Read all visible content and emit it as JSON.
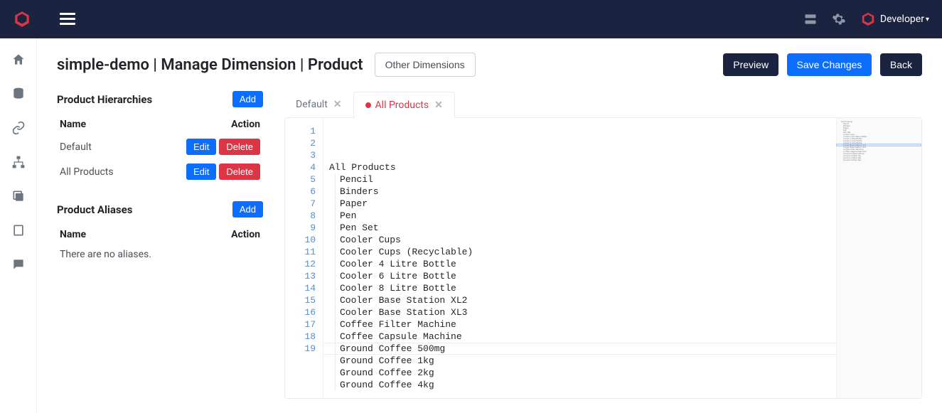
{
  "header": {
    "user_label": "Developer"
  },
  "page": {
    "title": "simple-demo | Manage Dimension | Product",
    "other_dimensions_btn": "Other Dimensions",
    "preview_btn": "Preview",
    "save_btn": "Save Changes",
    "back_btn": "Back"
  },
  "hierarchies": {
    "title": "Product Hierarchies",
    "add_btn": "Add",
    "col_name": "Name",
    "col_action": "Action",
    "edit_btn": "Edit",
    "delete_btn": "Delete",
    "rows": [
      {
        "name": "Default"
      },
      {
        "name": "All Products"
      }
    ]
  },
  "aliases": {
    "title": "Product Aliases",
    "add_btn": "Add",
    "col_name": "Name",
    "col_action": "Action",
    "empty": "There are no aliases."
  },
  "tabs": [
    {
      "label": "Default",
      "active": false,
      "dirty": false
    },
    {
      "label": "All Products",
      "active": true,
      "dirty": true
    }
  ],
  "editor": {
    "lines": [
      "All Products",
      "    Pencil",
      "    Binders",
      "    Paper",
      "    Pen",
      "    Pen Set",
      "    Cooler Cups",
      "    Cooler Cups (Recyclable)",
      "    Cooler 4 Litre Bottle",
      "    Cooler 6 Litre Bottle",
      "    Cooler 8 Litre Bottle",
      "    Cooler Base Station XL2",
      "    Cooler Base Station XL3",
      "    Coffee Filter Machine",
      "    Coffee Capsule Machine",
      "    Ground Coffee 500mg",
      "    Ground Coffee 1kg",
      "    Ground Coffee 2kg",
      "    Ground Coffee 4kg"
    ]
  }
}
